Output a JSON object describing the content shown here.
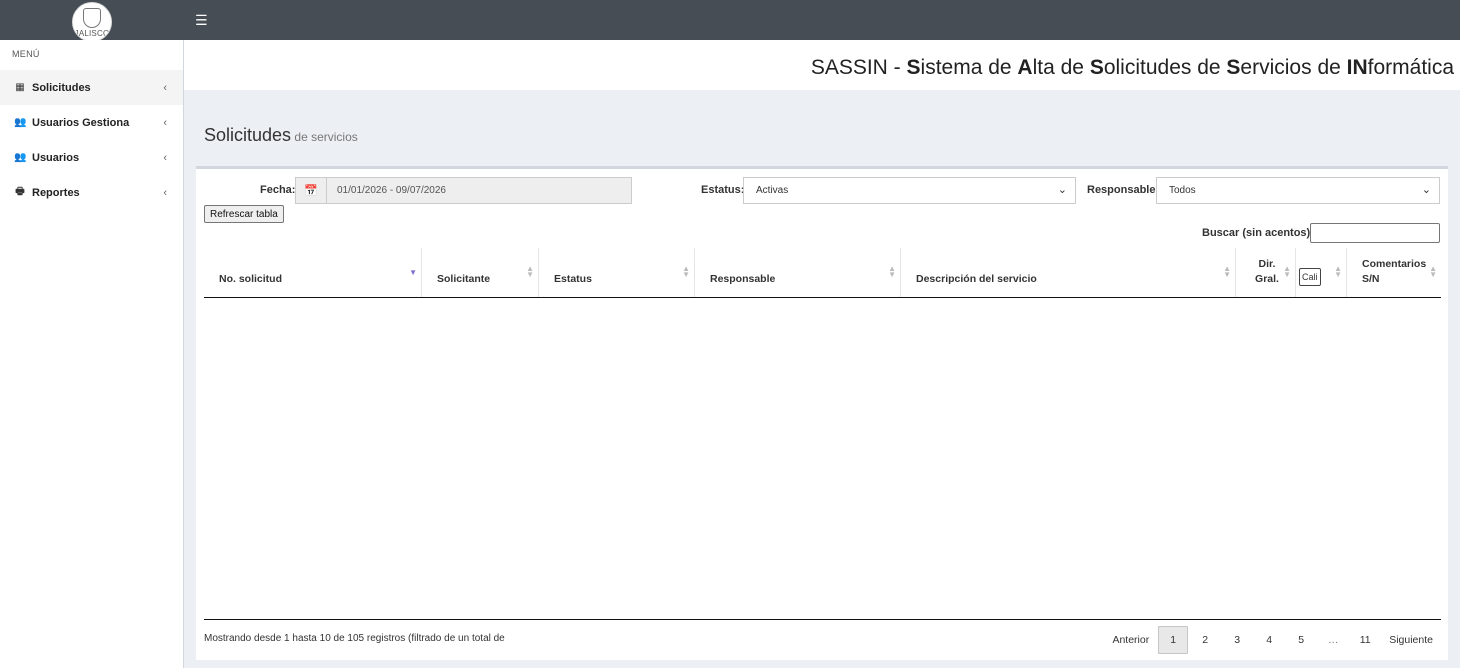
{
  "header": {
    "logo_text": "JALISCO",
    "menu_toggle_icon": "hamburger-icon"
  },
  "sidebar": {
    "menu_label": "MENÚ",
    "items": [
      {
        "label": "Solicitudes",
        "icon": "table-icon",
        "glyph": "▦"
      },
      {
        "label": "Usuarios Gestiona",
        "icon": "users-icon",
        "glyph": "👥"
      },
      {
        "label": "Usuarios",
        "icon": "users-icon",
        "glyph": "👥"
      },
      {
        "label": "Reportes",
        "icon": "print-icon",
        "glyph": "🖶"
      }
    ]
  },
  "app_title": {
    "segments": [
      {
        "text": "SASSIN - ",
        "bold": false
      },
      {
        "text": "S",
        "bold": true
      },
      {
        "text": "istema de ",
        "bold": false
      },
      {
        "text": "A",
        "bold": true
      },
      {
        "text": "lta de ",
        "bold": false
      },
      {
        "text": "S",
        "bold": true
      },
      {
        "text": "olicitudes de ",
        "bold": false
      },
      {
        "text": "S",
        "bold": true
      },
      {
        "text": "ervicios de ",
        "bold": false
      },
      {
        "text": "IN",
        "bold": true
      },
      {
        "text": "formática",
        "bold": false
      }
    ]
  },
  "page": {
    "title": "Solicitudes",
    "subtitle": "de servicios"
  },
  "filters": {
    "fecha_label": "Fecha:",
    "fecha_value": "01/01/2026 - 09/07/2026",
    "estatus_label": "Estatus:",
    "estatus_value": "Activas",
    "responsable_label": "Responsable:",
    "responsable_value": "Todos",
    "refresh_label": "Refrescar tabla",
    "search_label": "Buscar (sin acentos):",
    "search_value": ""
  },
  "table": {
    "columns": [
      {
        "label": "No. solicitud",
        "sorted": "desc"
      },
      {
        "label": "Solicitante"
      },
      {
        "label": "Estatus"
      },
      {
        "label": "Responsable"
      },
      {
        "label": "Descripción del servicio"
      },
      {
        "label": "Dir. Gral."
      },
      {
        "label": "Cali"
      },
      {
        "label": "Comentarios S/N"
      }
    ],
    "rows": []
  },
  "footer": {
    "info": "Mostrando desde 1 hasta 10 de 105 registros (filtrado de un total de",
    "pagination": {
      "prev": "Anterior",
      "pages": [
        "1",
        "2",
        "3",
        "4",
        "5",
        "…",
        "11"
      ],
      "current": "1",
      "next": "Siguiente"
    }
  }
}
